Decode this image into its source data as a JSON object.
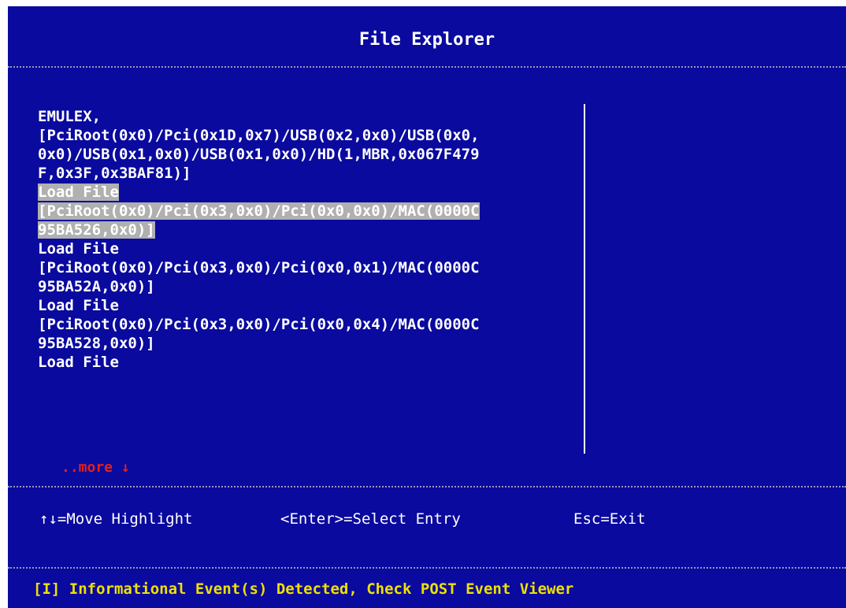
{
  "header": {
    "title": "File Explorer"
  },
  "entries": [
    {
      "lines": [
        "EMULEX,",
        "[PciRoot(0x0)/Pci(0x1D,0x7)/USB(0x2,0x0)/USB(0x0,",
        "0x0)/USB(0x1,0x0)/USB(0x1,0x0)/HD(1,MBR,0x067F479",
        "F,0x3F,0x3BAF81)]"
      ],
      "selected": false
    },
    {
      "lines": [
        "Load File",
        "[PciRoot(0x0)/Pci(0x3,0x0)/Pci(0x0,0x0)/MAC(0000C",
        "95BA526,0x0)]"
      ],
      "selected": true
    },
    {
      "lines": [
        "Load File",
        "[PciRoot(0x0)/Pci(0x3,0x0)/Pci(0x0,0x1)/MAC(0000C",
        "95BA52A,0x0)]"
      ],
      "selected": false
    },
    {
      "lines": [
        "Load File",
        "[PciRoot(0x0)/Pci(0x3,0x0)/Pci(0x0,0x4)/MAC(0000C",
        "95BA528,0x0)]"
      ],
      "selected": false
    },
    {
      "lines": [
        "Load File"
      ],
      "selected": false
    }
  ],
  "more_indicator": "..more ↓",
  "help": {
    "move": "↑↓=Move Highlight",
    "select": "<Enter>=Select Entry",
    "exit": "Esc=Exit"
  },
  "status_bar": {
    "message": "[I] Informational Event(s) Detected, Check POST Event Viewer"
  },
  "colors": {
    "background": "#0a0a9e",
    "text": "#ffffff",
    "highlight": "#b0b0b0",
    "more": "#e02020",
    "status": "#f0e000"
  }
}
